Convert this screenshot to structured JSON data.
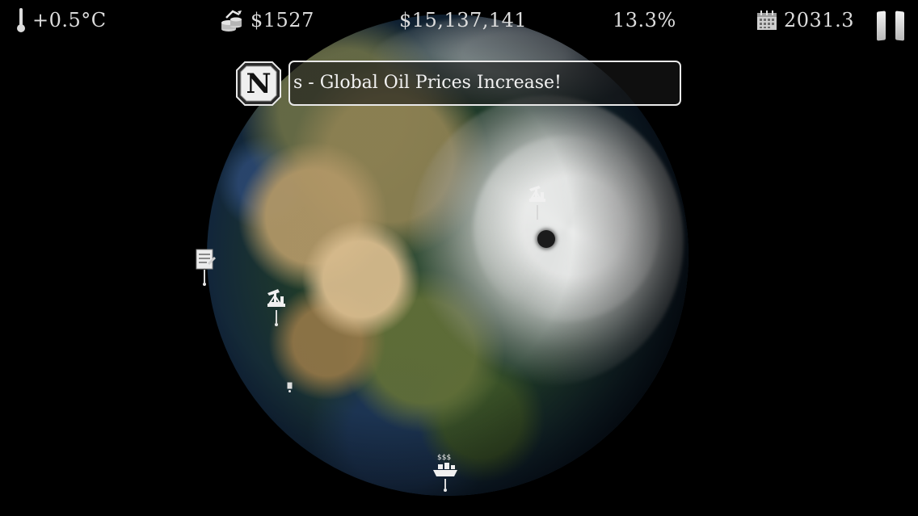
{
  "hud": {
    "temperature": "+0.5°C",
    "money": "$1527",
    "budget": "$15,137,141",
    "percentage": "13.3%",
    "date": "2031.3"
  },
  "news": {
    "badge_letter": "N",
    "ticker_text": "s - Global Oil Prices Increase!"
  },
  "markers": {
    "oil_platform_label": "$$$"
  },
  "icons": {
    "temperature": "thermometer-icon",
    "money": "coin-stack-icon",
    "date": "calendar-icon",
    "pause": "pause-icon",
    "oil_pump": "oil-pump-icon",
    "document": "document-icon",
    "oil_platform": "oil-platform-icon",
    "hurricane_eye": "hurricane-eye"
  },
  "colors": {
    "hud_text": "#dcdcdc",
    "background": "#000000",
    "ticker_border": "#e9e9e9"
  }
}
